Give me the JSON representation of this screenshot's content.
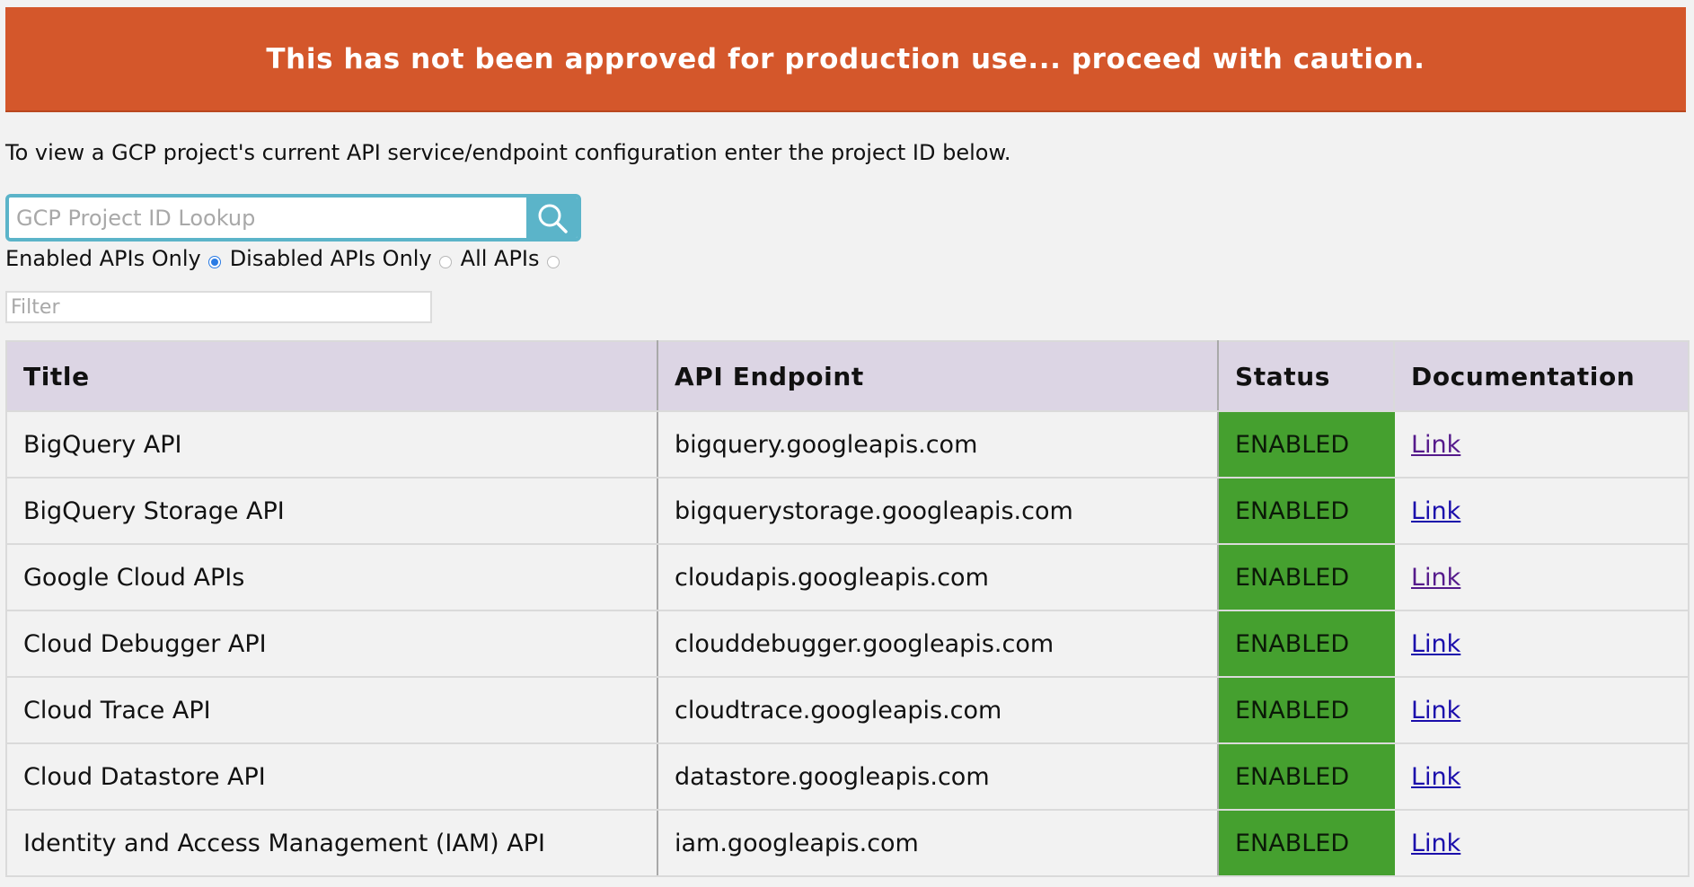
{
  "banner": {
    "text": "This has not been approved for production use... proceed with caution."
  },
  "intro": {
    "text": "To view a GCP project's current API service/endpoint configuration enter the project ID below."
  },
  "search": {
    "placeholder": "GCP Project ID Lookup",
    "value": "",
    "icon": "search-icon"
  },
  "filters": {
    "options": [
      {
        "label": "Enabled APIs Only",
        "checked": true
      },
      {
        "label": "Disabled APIs Only",
        "checked": false
      },
      {
        "label": "All APIs",
        "checked": false
      }
    ]
  },
  "filter_input": {
    "placeholder": "Filter",
    "value": ""
  },
  "table": {
    "headers": {
      "title": "Title",
      "endpoint": "API Endpoint",
      "status": "Status",
      "documentation": "Documentation"
    },
    "rows": [
      {
        "title": "BigQuery API",
        "endpoint": "bigquery.googleapis.com",
        "status": "ENABLED",
        "doc": "Link",
        "visited": true
      },
      {
        "title": "BigQuery Storage API",
        "endpoint": "bigquerystorage.googleapis.com",
        "status": "ENABLED",
        "doc": "Link",
        "visited": false
      },
      {
        "title": "Google Cloud APIs",
        "endpoint": "cloudapis.googleapis.com",
        "status": "ENABLED",
        "doc": "Link",
        "visited": true
      },
      {
        "title": "Cloud Debugger API",
        "endpoint": "clouddebugger.googleapis.com",
        "status": "ENABLED",
        "doc": "Link",
        "visited": false
      },
      {
        "title": "Cloud Trace API",
        "endpoint": "cloudtrace.googleapis.com",
        "status": "ENABLED",
        "doc": "Link",
        "visited": false
      },
      {
        "title": "Cloud Datastore API",
        "endpoint": "datastore.googleapis.com",
        "status": "ENABLED",
        "doc": "Link",
        "visited": false
      },
      {
        "title": "Identity and Access Management (IAM) API",
        "endpoint": "iam.googleapis.com",
        "status": "ENABLED",
        "doc": "Link",
        "visited": false
      }
    ]
  },
  "colors": {
    "banner": "#d4572b",
    "accent": "#5bb4c9",
    "header_bg": "#dcd5e4",
    "status_enabled": "#45a02f",
    "link": "#1a0dab",
    "link_visited": "#551a8b"
  }
}
